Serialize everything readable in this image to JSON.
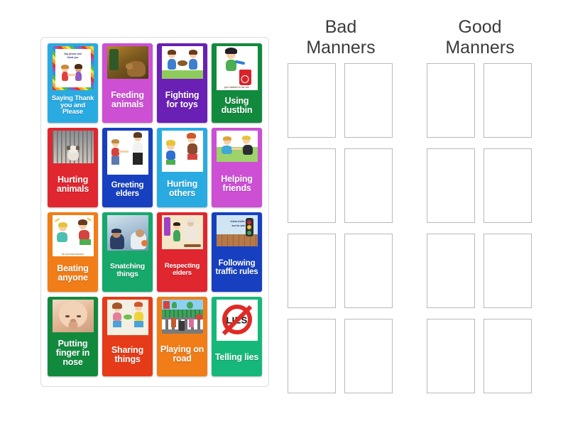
{
  "activity": {
    "type": "group-sort",
    "card_count": 16,
    "group_count": 2
  },
  "tray": {
    "name": "unsorted-card-tray",
    "cards": [
      {
        "label": "Saying Thank you and Please",
        "color": "#29abe2",
        "art": "poster-thank-you",
        "size": "s-9"
      },
      {
        "label": "Feeding animals",
        "color": "#cc4fd4",
        "art": "photo-feeding-animals",
        "size": "s-12"
      },
      {
        "label": "Fighting for toys",
        "color": "#6a1fb5",
        "art": "kids-fighting-toy",
        "size": "s-12"
      },
      {
        "label": "Using dustbin",
        "color": "#128a3e",
        "art": "boy-dustbin",
        "size": "s-12"
      },
      {
        "label": "Hurting animals",
        "color": "#e0262f",
        "art": "caged-dog",
        "size": "s-12"
      },
      {
        "label": "Greeting elders",
        "color": "#1640c0",
        "art": "child-greeting-adult",
        "size": "s-11"
      },
      {
        "label": "Hurting others",
        "color": "#29abe2",
        "art": "kids-hitting",
        "size": "s-12"
      },
      {
        "label": "Helping friends",
        "color": "#cc4fd4",
        "art": "helping-friend-up",
        "size": "s-12"
      },
      {
        "label": "Beating anyone",
        "color": "#f07d18",
        "art": "kids-beating",
        "size": "s-12"
      },
      {
        "label": "Snatching things",
        "color": "#17a86b",
        "art": "photo-snatching",
        "size": "s-10"
      },
      {
        "label": "Respecting elders",
        "color": "#e0262f",
        "art": "respect-grandparent",
        "size": "s-9"
      },
      {
        "label": "Following traffic rules",
        "color": "#1640c0",
        "art": "traffic-light",
        "size": "s-11"
      },
      {
        "label": "Putting finger in nose",
        "color": "#128a3e",
        "art": "photo-baby-nose",
        "size": "s-12"
      },
      {
        "label": "Sharing things",
        "color": "#e63b18",
        "art": "kids-sharing",
        "size": "s-12"
      },
      {
        "label": "Playing on road",
        "color": "#f07d18",
        "art": "kids-on-road",
        "size": "s-12"
      },
      {
        "label": "Telling lies",
        "color": "#16b879",
        "art": "no-lies-sign",
        "size": "s-12"
      }
    ]
  },
  "dropzones": {
    "groups": [
      {
        "title": "Bad\nManners",
        "slots": 8
      },
      {
        "title": "Good\nManners",
        "slots": 8
      }
    ]
  },
  "colors": {
    "page_background": "#ffffff",
    "tray_border": "#dcdcdc",
    "slot_border": "#b9b9b9",
    "title_text": "#3b3b3b"
  }
}
